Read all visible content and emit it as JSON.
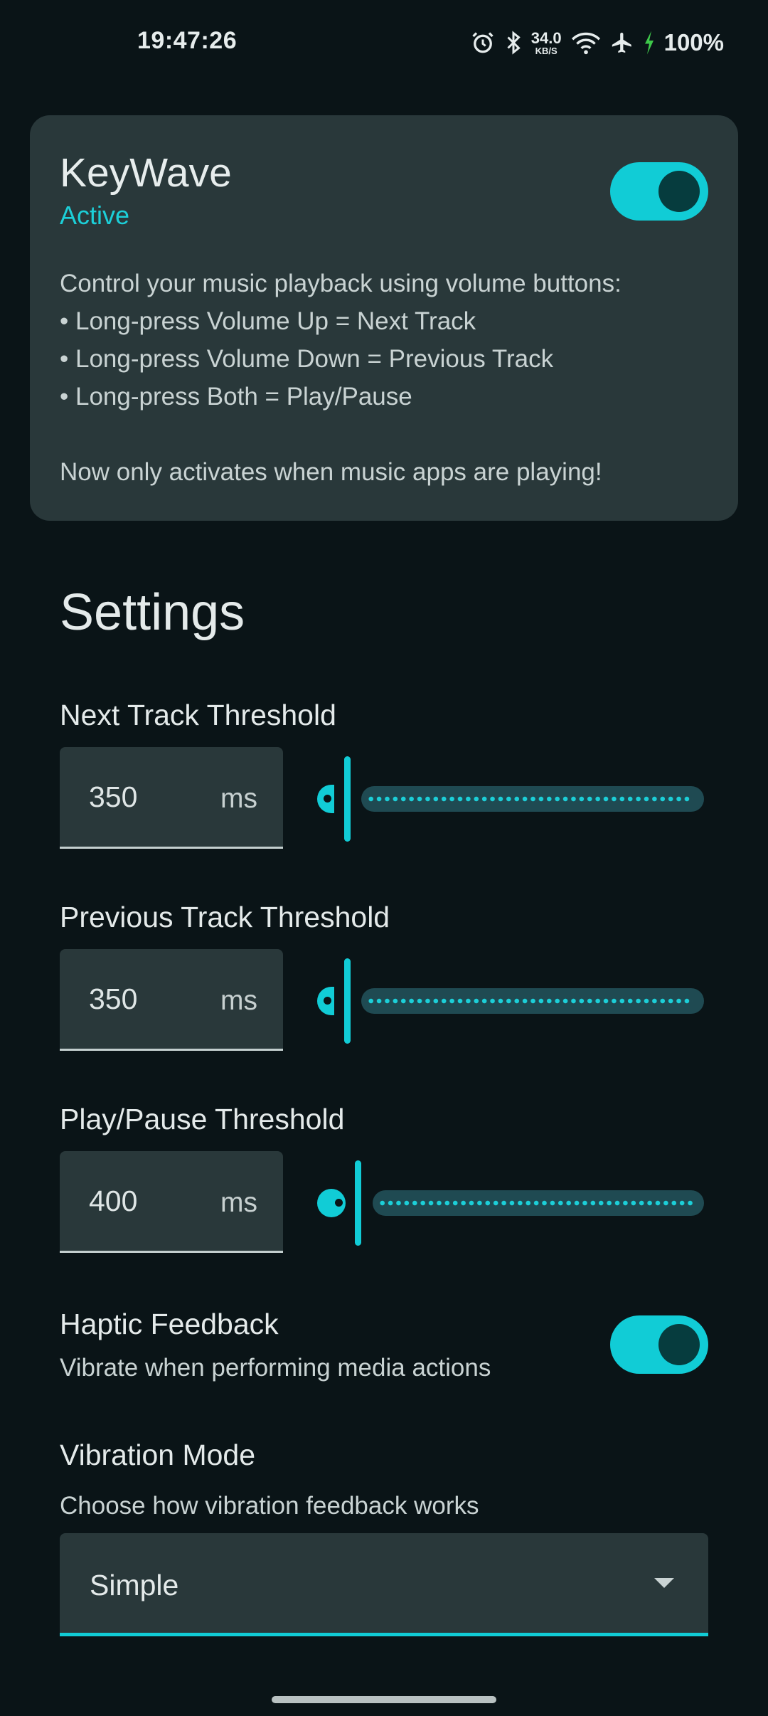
{
  "status_bar": {
    "time": "19:47:26",
    "net_speed_value": "34.0",
    "net_speed_unit": "KB/S",
    "battery": "100%",
    "icons": [
      "alarm-icon",
      "bluetooth-icon",
      "network-speed",
      "wifi-6-icon",
      "airplane-icon",
      "charging-icon"
    ]
  },
  "app_card": {
    "title": "KeyWave",
    "status": "Active",
    "enabled": true,
    "description": {
      "intro": "Control your music playback using volume buttons:",
      "bullets": [
        "• Long-press Volume Up = Next Track",
        "• Long-press Volume Down = Previous Track",
        "• Long-press Both = Play/Pause"
      ],
      "note": "Now only activates when music apps are playing!"
    }
  },
  "settings": {
    "title": "Settings",
    "thresholds": [
      {
        "label": "Next Track Threshold",
        "value": "350",
        "unit": "ms"
      },
      {
        "label": "Previous Track Threshold",
        "value": "350",
        "unit": "ms"
      },
      {
        "label": "Play/Pause Threshold",
        "value": "400",
        "unit": "ms"
      }
    ],
    "haptic": {
      "title": "Haptic Feedback",
      "subtitle": "Vibrate when performing media actions",
      "enabled": true
    },
    "vibration_mode": {
      "title": "Vibration Mode",
      "subtitle": "Choose how vibration feedback works",
      "selected": "Simple"
    }
  },
  "colors": {
    "accent": "#11ccd6",
    "background": "#0a1417",
    "surface": "#29383a"
  }
}
